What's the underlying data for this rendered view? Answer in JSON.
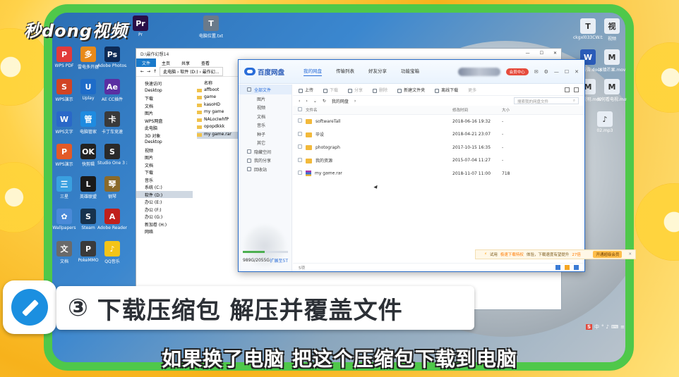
{
  "brand": {
    "logo_text": "秒dong视频"
  },
  "desktop_icons_left": [
    {
      "label": "WPS PDF",
      "color": "#e23b3b",
      "glyph": "P"
    },
    {
      "label": "雷电多开器",
      "color": "#e88a1a",
      "glyph": "多"
    },
    {
      "label": "Adobe Photos...",
      "color": "#0d2a55",
      "glyph": "Ps"
    },
    {
      "label": "WPS演示",
      "color": "#d14424",
      "glyph": "S"
    },
    {
      "label": "Uplay",
      "color": "#1e6cc8",
      "glyph": "U"
    },
    {
      "label": "AE CC插件",
      "color": "#5a2fa2",
      "glyph": "Ae"
    },
    {
      "label": "WPS文字",
      "color": "#2a68c8",
      "glyph": "W"
    },
    {
      "label": "电脑管家",
      "color": "#1f8be0",
      "glyph": "管"
    },
    {
      "label": "卡丁车竞速",
      "color": "#3a3a3a",
      "glyph": "卡"
    },
    {
      "label": "WPS演示",
      "color": "#e25a28",
      "glyph": "P"
    },
    {
      "label": "快剪辑",
      "color": "#222",
      "glyph": "OK"
    },
    {
      "label": "Studio One 3 x64",
      "color": "#2a2a2a",
      "glyph": "S"
    },
    {
      "label": "三星",
      "color": "#3aa0e0",
      "glyph": "三"
    },
    {
      "label": "英雄联盟",
      "color": "#1a1a1a",
      "glyph": "L"
    },
    {
      "label": "钢琴",
      "color": "#8a6a2a",
      "glyph": "琴"
    },
    {
      "label": "Wallpapers",
      "color": "#4a8ad8",
      "glyph": "✿"
    },
    {
      "label": "Steam",
      "color": "#17324d",
      "glyph": "S"
    },
    {
      "label": "Adobe Reader XI",
      "color": "#c0201c",
      "glyph": "A"
    },
    {
      "label": "文档",
      "color": "#6a6a6a",
      "glyph": "文"
    },
    {
      "label": "PokeMMO",
      "color": "#3a3a3a",
      "glyph": "P"
    },
    {
      "label": "QQ音乐",
      "color": "#f3c418",
      "glyph": "♪"
    }
  ],
  "desktop_icons_top": [
    {
      "label": "Pr",
      "color": "#2a0f47",
      "glyph": "Pr"
    },
    {
      "label": "电脑位置.txt",
      "color": "#6a7a8a",
      "glyph": "T"
    }
  ],
  "desktop_icons_right": [
    {
      "label": "ckgxl033CW.txt",
      "color": "#e8eef5",
      "glyph": "T"
    },
    {
      "label": "视频",
      "color": "#e8eef5",
      "glyph": "视"
    },
    {
      "label": "实验报告.docx",
      "color": "#2a5bb8",
      "glyph": "W"
    },
    {
      "label": "冰镇芒果.mov",
      "color": "#e8eef5",
      "glyph": "M"
    },
    {
      "label": "实验说明.mov",
      "color": "#e8eef5",
      "glyph": "M"
    },
    {
      "label": "如何看电视.mov",
      "color": "#e8eef5",
      "glyph": "M"
    },
    {
      "label": "02.mp3",
      "color": "#e8eef5",
      "glyph": "♪"
    }
  ],
  "explorer": {
    "title": "D:\\最作幻想14",
    "menu": [
      "文件",
      "主页",
      "共享",
      "查看"
    ],
    "path_label": "此电脑 › 软件 (D:) › 最作幻...",
    "nav": [
      "快速访问",
      "Desktop",
      "下载",
      "文档",
      "图片",
      "WPS网盘",
      "此电脑",
      "3D 对象",
      "Desktop",
      "视频",
      "图片",
      "文档",
      "下载",
      "音乐",
      "系统 (C:)",
      "软件 (D:)",
      "办公 (E:)",
      "办公 (F:)",
      "办公 (G:)",
      "新加卷 (H:)",
      "网络"
    ],
    "list_header": "名称",
    "list": [
      "affboot",
      "game",
      "kasoHD",
      "my game",
      "NALocIwhfP",
      "opopdkkk",
      "my game.rar"
    ]
  },
  "baidu": {
    "app_name": "百度网盘",
    "tabs": [
      "我的网盘",
      "传输列表",
      "好友分享",
      "功能宝箱"
    ],
    "vip_label": "会员中心",
    "window_buttons": [
      "✉",
      "⚙",
      "—",
      "☐",
      "✕"
    ],
    "sidebar": [
      "全部文件",
      "图片",
      "视频",
      "文档",
      "音乐",
      "种子",
      "其它",
      "隐藏空间",
      "我的分享",
      "回收站"
    ],
    "storage": {
      "used": "989G/2055G",
      "expand": "扩展至5T",
      "fraction": 0.48
    },
    "toolbar": [
      "上传",
      "下载",
      "分享",
      "删除",
      "新建文件夹",
      "离线下载",
      "更多"
    ],
    "breadcrumb": "我的网盘",
    "search_placeholder": "搜索我的网盘文件",
    "columns": {
      "name": "文件名",
      "time": "修改时间",
      "size": "大小"
    },
    "files": [
      {
        "name": "softwareTall",
        "time": "2018-06-16 19:32",
        "size": "-",
        "type": "folder"
      },
      {
        "name": "毕设",
        "time": "2018-04-21 23:07",
        "size": "-",
        "type": "folder"
      },
      {
        "name": "photograph",
        "time": "2017-10-15 16:35",
        "size": "-",
        "type": "folder"
      },
      {
        "name": "我的资源",
        "time": "2015-07-04 11:27",
        "size": "-",
        "type": "folder"
      },
      {
        "name": "my game.rar",
        "time": "2018-11-07 11:00",
        "size": "718",
        "type": "rar"
      }
    ],
    "promo": {
      "text1": "试用",
      "highlight": "极速下载特权",
      "text2": "体验，下载速度有望提升",
      "num": "27倍",
      "button": "开通超级会员"
    },
    "footer_count": "5项"
  },
  "step": {
    "number": "③",
    "title": "下载压缩包 解压并覆盖文件"
  },
  "tray": {
    "ime": "S",
    "items": [
      "中",
      "°",
      "♪",
      "⌨",
      "≡"
    ]
  },
  "subtitle": "如果换了电脑 把这个压缩包下载到电脑"
}
